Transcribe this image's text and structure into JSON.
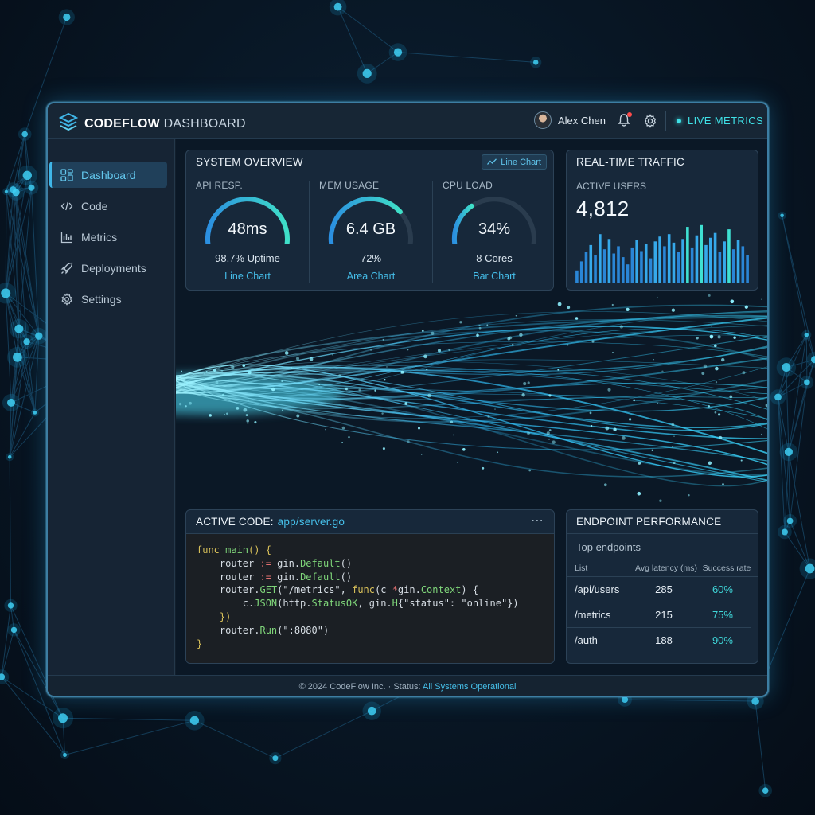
{
  "app": {
    "brand_bold": "CODEFLOW",
    "brand_light": "DASHBOARD",
    "user_name": "Alex Chen",
    "live_label": "LIVE METRICS"
  },
  "icons": {
    "logo": "codeflow-logo-icon",
    "bell": "bell-icon",
    "settings": "gear-icon",
    "live": "status-dot-icon"
  },
  "sidebar": {
    "items": [
      {
        "label": "Dashboard",
        "icon": "grid-icon",
        "active": true
      },
      {
        "label": "Code",
        "icon": "code-icon",
        "active": false
      },
      {
        "label": "Metrics",
        "icon": "bar-chart-icon",
        "active": false
      },
      {
        "label": "Deployments",
        "icon": "rocket-icon",
        "active": false
      },
      {
        "label": "Settings",
        "icon": "gear-icon",
        "active": false
      }
    ]
  },
  "system_overview": {
    "title": "SYSTEM OVERVIEW",
    "chart_toggle": "Line Chart",
    "metrics": [
      {
        "label": "API RESP.",
        "value": "48ms",
        "sub": "98.7% Uptime",
        "link": "Line Chart",
        "fill": 0.98
      },
      {
        "label": "MEM USAGE",
        "value": "6.4 GB",
        "sub": "72%",
        "link": "Area Chart",
        "fill": 0.72
      },
      {
        "label": "CPU LOAD",
        "value": "34%",
        "sub": "8 Cores",
        "link": "Bar Chart",
        "fill": 0.34
      }
    ]
  },
  "traffic": {
    "title": "REAL-TIME TRAFFIC",
    "active_users_label": "ACTIVE USERS",
    "active_users_value": "4,812",
    "bars": [
      0.2,
      0.35,
      0.5,
      0.62,
      0.45,
      0.8,
      0.55,
      0.72,
      0.48,
      0.6,
      0.42,
      0.3,
      0.58,
      0.7,
      0.52,
      0.64,
      0.4,
      0.68,
      0.76,
      0.6,
      0.8,
      0.66,
      0.5,
      0.72,
      0.92,
      0.58,
      0.78,
      0.95,
      0.62,
      0.74,
      0.82,
      0.5,
      0.68,
      0.88,
      0.55,
      0.7,
      0.6,
      0.45
    ]
  },
  "code": {
    "title_prefix": "ACTIVE CODE:",
    "file": "app/server.go",
    "menu": "⋯",
    "lines": [
      [
        {
          "t": "func ",
          "c": "k"
        },
        {
          "t": "main",
          "c": "f"
        },
        {
          "t": "() {",
          "c": "k"
        }
      ],
      [
        {
          "t": "    router ",
          "c": ""
        },
        {
          "t": ":=",
          "c": "p"
        },
        {
          "t": " gin.",
          "c": ""
        },
        {
          "t": "Default",
          "c": "f"
        },
        {
          "t": "()",
          "c": ""
        }
      ],
      [
        {
          "t": "    router ",
          "c": ""
        },
        {
          "t": ":=",
          "c": "p"
        },
        {
          "t": " gin.",
          "c": ""
        },
        {
          "t": "Default",
          "c": "f"
        },
        {
          "t": "()",
          "c": ""
        }
      ],
      [
        {
          "t": "    router.",
          "c": ""
        },
        {
          "t": "GET",
          "c": "f"
        },
        {
          "t": "(\"/metrics\", ",
          "c": ""
        },
        {
          "t": "func",
          "c": "k"
        },
        {
          "t": "(c ",
          "c": ""
        },
        {
          "t": "*",
          "c": "p"
        },
        {
          "t": "gin.",
          "c": ""
        },
        {
          "t": "Context",
          "c": "f"
        },
        {
          "t": ") {",
          "c": ""
        }
      ],
      [
        {
          "t": "        c.",
          "c": ""
        },
        {
          "t": "JSON",
          "c": "f"
        },
        {
          "t": "(http.",
          "c": ""
        },
        {
          "t": "StatusOK",
          "c": "f"
        },
        {
          "t": ", gin.",
          "c": ""
        },
        {
          "t": "H",
          "c": "f"
        },
        {
          "t": "{\"status\": \"online\"})",
          "c": ""
        }
      ],
      [
        {
          "t": "    })",
          "c": "k"
        }
      ],
      [
        {
          "t": "    router.",
          "c": ""
        },
        {
          "t": "Run",
          "c": "f"
        },
        {
          "t": "(\":8080\")",
          "c": ""
        }
      ],
      [
        {
          "t": "}",
          "c": "k"
        }
      ]
    ]
  },
  "endpoints": {
    "title": "ENDPOINT PERFORMANCE",
    "subtitle": "Top endpoints",
    "headers": [
      "List",
      "Avg latency (ms)",
      "Success rate"
    ],
    "rows": [
      [
        "/api/users",
        "285",
        "60%"
      ],
      [
        "/metrics",
        "215",
        "75%"
      ],
      [
        "/auth",
        "188",
        "90%"
      ]
    ]
  },
  "footer": {
    "text": "© 2024 CodeFlow Inc. · Status:",
    "status": "All Systems Operational"
  },
  "colors": {
    "accent": "#3fb6e8",
    "live": "#3fe0e6",
    "frame": "#3d7ea3",
    "background": "#081624"
  }
}
